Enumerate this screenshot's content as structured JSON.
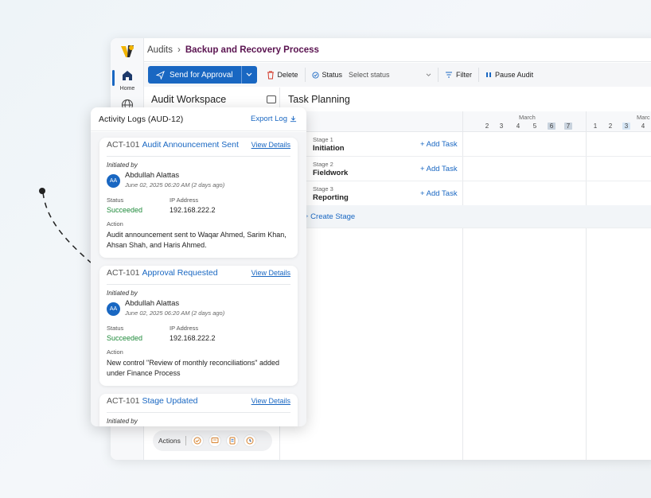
{
  "breadcrumb": {
    "parent": "Audits",
    "separator": "›",
    "current": "Backup and Recovery Process"
  },
  "sidebar": {
    "home_label": "Home"
  },
  "toolbar": {
    "send_label": "Send for Approval",
    "delete_label": "Delete",
    "status_label": "Status",
    "status_placeholder": "Select status",
    "filter_label": "Filter",
    "pause_label": "Pause Audit"
  },
  "workspace": {
    "title": "Audit Workspace"
  },
  "task_planning": {
    "title": "Task Planning",
    "months": [
      "March",
      "Marc"
    ],
    "days_a": [
      "2",
      "3",
      "4",
      "5",
      "6",
      "7"
    ],
    "days_b": [
      "1",
      "2",
      "3",
      "4"
    ],
    "stages": [
      {
        "num": "Stage 1",
        "name": "Initiation",
        "add": "+ Add Task"
      },
      {
        "num": "Stage 2",
        "name": "Fieldwork",
        "add": "+ Add Task"
      },
      {
        "num": "Stage 3",
        "name": "Reporting",
        "add": "+ Add Task"
      }
    ],
    "create_stage": "+ Create Stage"
  },
  "actions": {
    "label": "Actions"
  },
  "activity_panel": {
    "title": "Activity Logs (AUD-12)",
    "export_label": "Export Log",
    "initiated_label": "Initiated by",
    "status_label": "Status",
    "ip_label": "IP Address",
    "action_label": "Action",
    "view_label": "View Details",
    "logs": [
      {
        "id": "ACT-101",
        "title": "Audit Announcement Sent",
        "avatar": "AA",
        "user": "Abdullah Alattas",
        "date": "June 02, 2025 06:20 AM (2 days ago)",
        "status": "Succeeded",
        "ip": "192.168.222.2",
        "action": "Audit announcement sent to Waqar Ahmed, Sarim Khan, Ahsan Shah, and Haris Ahmed."
      },
      {
        "id": "ACT-101",
        "title": "Approval Requested",
        "avatar": "AA",
        "user": "Abdullah Alattas",
        "date": "June 02, 2025 06:20 AM (2 days ago)",
        "status": "Succeeded",
        "ip": "192.168.222.2",
        "action": "New control \"Review of monthly reconciliations\" added under Finance Process"
      },
      {
        "id": "ACT-101",
        "title": "Stage Updated",
        "avatar": "",
        "user": "",
        "date": "",
        "status": "",
        "ip": "",
        "action": ""
      }
    ]
  },
  "colors": {
    "accent": "#1967c2",
    "brand": "#5a1350",
    "success": "#1e8a3a"
  }
}
